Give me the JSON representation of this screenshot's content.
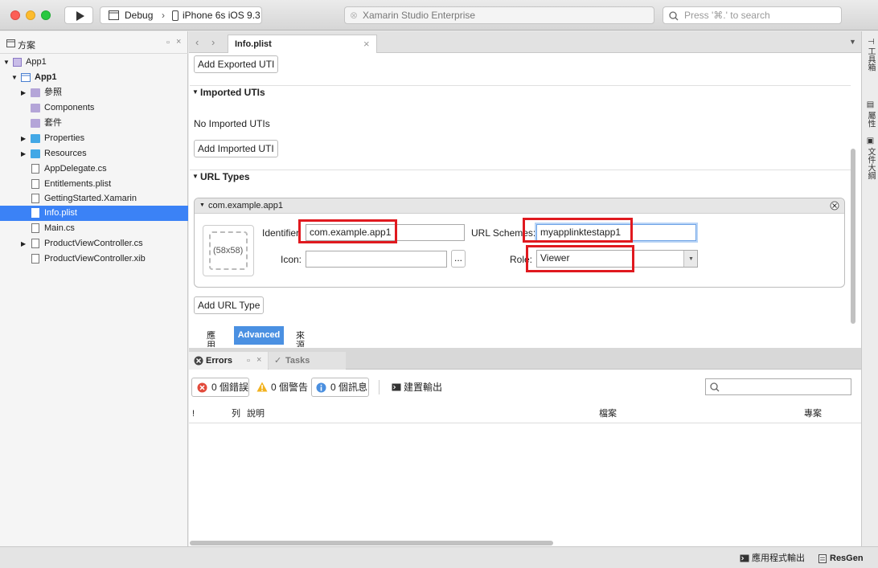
{
  "toolbar": {
    "config": "Debug",
    "device": "iPhone 6s iOS 9.3",
    "app_title": "Xamarin Studio Enterprise",
    "search_placeholder": "Press '⌘.' to search"
  },
  "sidebar": {
    "title": "方案",
    "items": [
      {
        "label": "App1",
        "bold": false
      },
      {
        "label": "App1",
        "bold": true
      },
      {
        "label": "參照"
      },
      {
        "label": "Components"
      },
      {
        "label": "套件"
      },
      {
        "label": "Properties"
      },
      {
        "label": "Resources"
      },
      {
        "label": "AppDelegate.cs"
      },
      {
        "label": "Entitlements.plist"
      },
      {
        "label": "GettingStarted.Xamarin"
      },
      {
        "label": "Info.plist",
        "selected": true
      },
      {
        "label": "Main.cs"
      },
      {
        "label": "ProductViewController.cs"
      },
      {
        "label": "ProductViewController.xib"
      }
    ]
  },
  "editor": {
    "tab_title": "Info.plist",
    "add_exported_uti": "Add Exported UTI",
    "imported_utis_header": "Imported UTIs",
    "no_imported_utis": "No Imported UTIs",
    "add_imported_uti": "Add Imported UTI",
    "url_types_header": "URL Types",
    "url_type_name": "com.example.app1",
    "image_placeholder": "(58x58)",
    "identifier_label": "Identifier",
    "identifier_value": "com.example.app1",
    "url_schemes_label": "URL Schemes:",
    "url_schemes_value": "myapplinktestapp1",
    "icon_label": "Icon:",
    "icon_value": "",
    "browse_button": "...",
    "role_label": "Role:",
    "role_value": "Viewer",
    "add_url_type": "Add URL Type",
    "bottom_tab_left": "應用",
    "bottom_tab_active": "Advanced",
    "bottom_tab_right": "來源"
  },
  "errors_pad": {
    "tab_errors": "Errors",
    "tab_tasks": "Tasks",
    "errors_count": "0 個錯誤",
    "warnings_count": "0 個警告",
    "messages_count": "0 個訊息",
    "build_output": "建置輸出",
    "col_bang": "!",
    "col_line": "列",
    "col_desc": "說明",
    "col_file": "檔案",
    "col_project": "專案"
  },
  "right_pads": {
    "toolbox": "工具箱",
    "properties": "屬性",
    "document_outline": "文件大綱"
  },
  "statusbar": {
    "app_output": "應用程式輸出",
    "resgen": "ResGen"
  },
  "colors": {
    "selection": "#3b82f6",
    "highlight_red": "#e0191f",
    "advanced_tab": "#4a90e2"
  }
}
